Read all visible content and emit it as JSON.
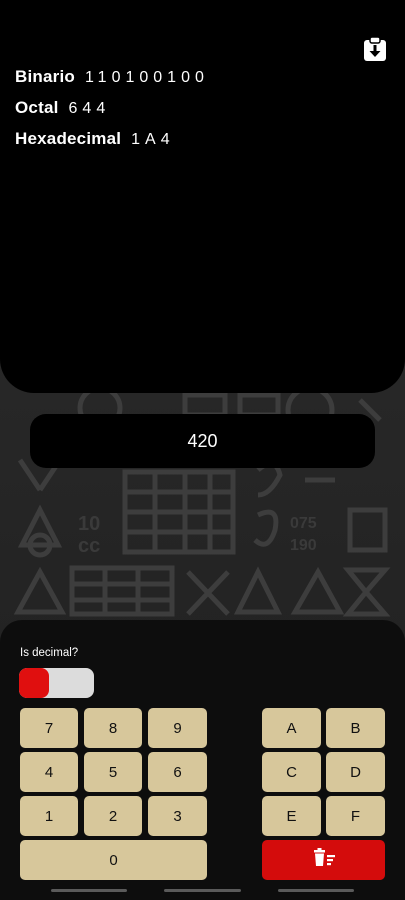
{
  "results": {
    "binary_label": "Binario",
    "binary_value": "110100100",
    "octal_label": "Octal",
    "octal_value": "644",
    "hex_label": "Hexadecimal",
    "hex_value": "1A4"
  },
  "clipboard_icon": "clipboard-download-icon",
  "input": {
    "value": "420"
  },
  "toggle": {
    "label": "Is decimal?",
    "on_color": "#e00f0f",
    "off_color": "#dcdcdc"
  },
  "keypad": {
    "digits": [
      "7",
      "8",
      "9",
      "4",
      "5",
      "6",
      "1",
      "2",
      "3",
      "0"
    ],
    "hex": [
      "A",
      "B",
      "C",
      "D",
      "E",
      "F"
    ],
    "delete_icon": "trash-clear-icon"
  },
  "colors": {
    "key": "#d7c79b",
    "delete": "#d40c0c",
    "panel": "#000000"
  }
}
